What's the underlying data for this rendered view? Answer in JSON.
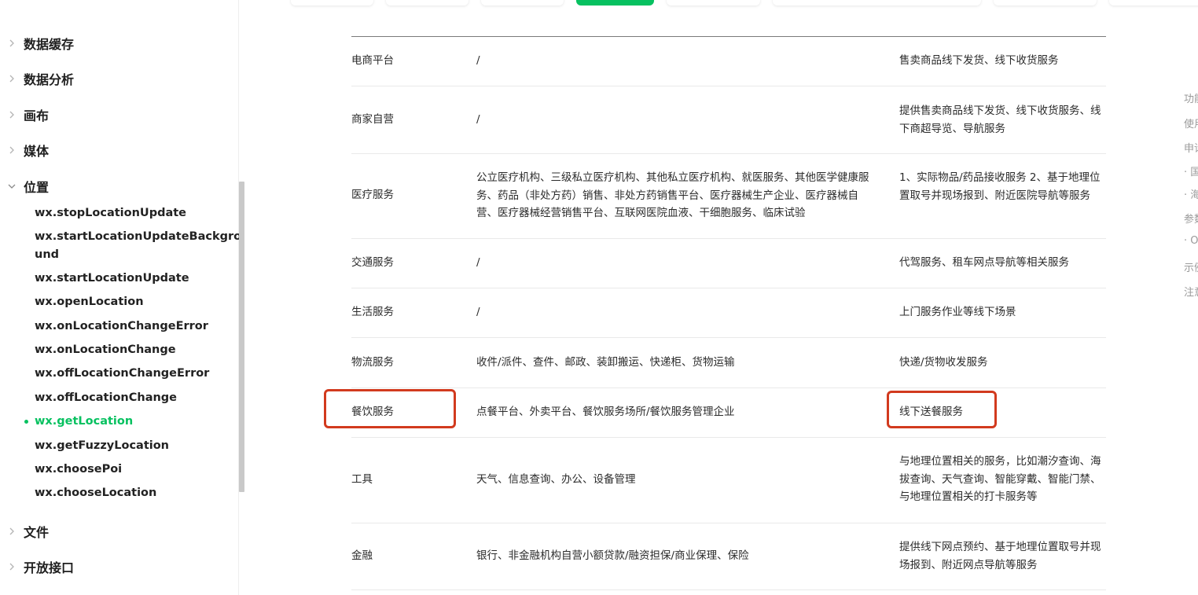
{
  "sidebar": {
    "categories_top": [
      "数据缓存",
      "数据分析",
      "画布",
      "媒体",
      "位置"
    ],
    "location_items": [
      "wx.stopLocationUpdate",
      "wx.startLocationUpdateBackground",
      "wx.startLocationUpdate",
      "wx.openLocation",
      "wx.onLocationChangeError",
      "wx.onLocationChange",
      "wx.offLocationChangeError",
      "wx.offLocationChange",
      "wx.getLocation",
      "wx.getFuzzyLocation",
      "wx.choosePoi",
      "wx.chooseLocation"
    ],
    "active_item": "wx.getLocation",
    "categories_bottom": [
      "文件",
      "开放接口"
    ]
  },
  "table": {
    "rows": [
      {
        "category": "电商平台",
        "sub": "/",
        "scene": "售卖商品线下发货、线下收货服务"
      },
      {
        "category": "商家自营",
        "sub": "/",
        "scene": "提供售卖商品线下发货、线下收货服务、线下商超导览、导航服务"
      },
      {
        "category": "医疗服务",
        "sub": "公立医疗机构、三级私立医疗机构、其他私立医疗机构、就医服务、其他医学健康服务、药品（非处方药）销售、非处方药销售平台、医疗器械生产企业、医疗器械自营、医疗器械经营销售平台、互联网医院血液、干细胞服务、临床试验",
        "scene": "1、实际物品/药品接收服务 2、基于地理位置取号并现场报到、附近医院导航等服务"
      },
      {
        "category": "交通服务",
        "sub": "/",
        "scene": "代驾服务、租车网点导航等相关服务"
      },
      {
        "category": "生活服务",
        "sub": "/",
        "scene": "上门服务作业等线下场景"
      },
      {
        "category": "物流服务",
        "sub": "收件/派件、查件、邮政、装卸搬运、快递柜、货物运输",
        "scene": "快递/货物收发服务"
      },
      {
        "category": "餐饮服务",
        "sub": "点餐平台、外卖平台、餐饮服务场所/餐饮服务管理企业",
        "scene": "线下送餐服务"
      },
      {
        "category": "工具",
        "sub": "天气、信息查询、办公、设备管理",
        "scene": "与地理位置相关的服务，比如潮汐查询、海拔查询、天气查询、智能穿戴、智能门禁、与地理位置相关的打卡服务等"
      },
      {
        "category": "金融",
        "sub": "银行、非金融机构自营小额贷款/融资担保/商业保理、保险",
        "scene": "提供线下网点预约、基于地理位置取号并现场报到、附近网点导航等服务"
      }
    ]
  },
  "toc": [
    "功能",
    "使用",
    "申请",
    "· 国",
    "· 海",
    "参数",
    "· O",
    "示例",
    "注意"
  ],
  "colors": {
    "accent": "#07c160",
    "highlight": "#d23a1e"
  }
}
